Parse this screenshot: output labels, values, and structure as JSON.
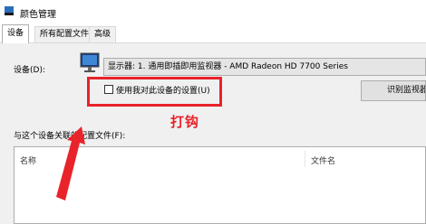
{
  "window": {
    "title": "颜色管理"
  },
  "tabs": [
    {
      "label": "设备",
      "active": true
    },
    {
      "label": "所有配置文件",
      "active": false
    },
    {
      "label": "高级",
      "active": false
    }
  ],
  "device": {
    "label": "设备(D):",
    "selected": "显示器: 1. 通用即插即用监视器 - AMD Radeon HD 7700 Series"
  },
  "use_my_settings": {
    "label": "使用我对此设备的设置(U)",
    "checked": false
  },
  "identify_button": {
    "label": "识别监视器"
  },
  "annotation": {
    "text": "打钩",
    "color": "#e8232a"
  },
  "profiles": {
    "label": "与这个设备关联的配置文件(F):",
    "columns": [
      "名称",
      "文件名"
    ]
  }
}
